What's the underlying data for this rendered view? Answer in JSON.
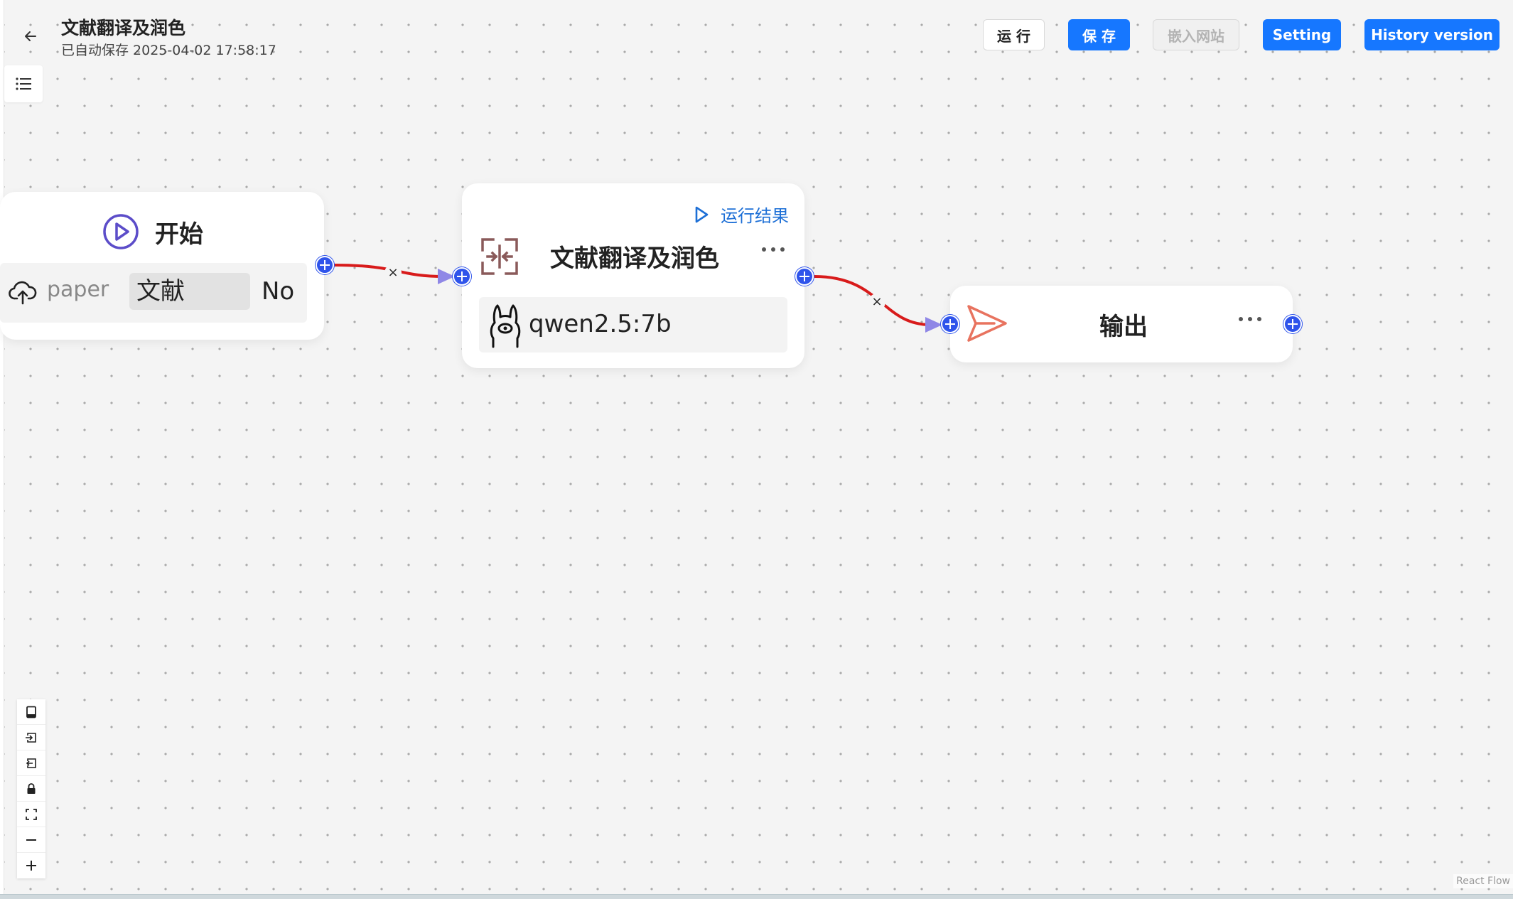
{
  "header": {
    "title": "文献翻译及润色",
    "autosave": "已自动保存 2025-04-02 17:58:17",
    "buttons": {
      "run": "运 行",
      "save": "保 存",
      "embed": "嵌入网站",
      "setting": "Setting",
      "history": "History version"
    }
  },
  "nodes": {
    "start": {
      "title": "开始",
      "params": [
        {
          "name": "paper",
          "label": "文献",
          "required": "No"
        }
      ]
    },
    "llm": {
      "title": "文献翻译及润色",
      "run_result": "运行结果",
      "model": "qwen2.5:7b"
    },
    "output": {
      "title": "输出"
    }
  },
  "edges": [
    {
      "from": "start",
      "to": "llm",
      "delete_label": "×"
    },
    {
      "from": "llm",
      "to": "output",
      "delete_label": "×"
    }
  ],
  "attribution": "React Flow",
  "icons": {
    "back": "arrow-left-icon",
    "menu": "list-icon",
    "start": "play-circle-icon",
    "upload": "cloud-upload-icon",
    "llm": "collapse-icon",
    "model": "llama-icon",
    "output": "send-icon",
    "controls": [
      "panel-icon",
      "import-icon",
      "export-icon",
      "lock-icon",
      "fit-view-icon",
      "zoom-out-icon",
      "zoom-in-icon"
    ]
  },
  "colors": {
    "primary": "#1677ff",
    "handle": "#2f54eb",
    "edge": "#d81b1b",
    "arrow": "#8f87e6",
    "start_icon": "#5c4dc9",
    "llm_icon": "#8a5a5a",
    "output_icon": "#e8735f",
    "run_result": "#1d6fd6"
  }
}
